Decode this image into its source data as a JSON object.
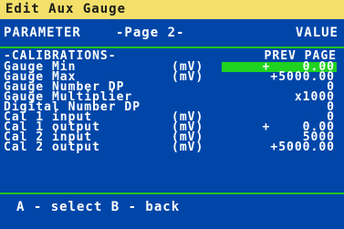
{
  "title": "Edit Aux Gauge",
  "header": {
    "parameter": "PARAMETER",
    "page": "-Page 2-",
    "value": "VALUE"
  },
  "section": {
    "label": "-CALIBRATIONS-",
    "prev_page": "PREV PAGE"
  },
  "rows": [
    {
      "label": "Gauge Min",
      "unit": "(mV)",
      "value": "+    0.00",
      "selected": true
    },
    {
      "label": "Gauge Max",
      "unit": "(mV)",
      "value": "+5000.00"
    },
    {
      "label": "Gauge Number DP",
      "unit": "",
      "value": "0"
    },
    {
      "label": "Gauge Multiplier",
      "unit": "",
      "value": "x1000"
    },
    {
      "label": "Digital Number DP",
      "unit": "",
      "value": "0"
    },
    {
      "label": "Cal 1 input",
      "unit": "(mV)",
      "value": "0"
    },
    {
      "label": "Cal 1 output",
      "unit": "(mV)",
      "value": "+    0.00"
    },
    {
      "label": "Cal 2 input",
      "unit": "(mV)",
      "value": "5000"
    },
    {
      "label": "Cal 2 output",
      "unit": "(mV)",
      "value": "+5000.00"
    }
  ],
  "footer": "A - select  B - back",
  "colors": {
    "background": "#0046a8",
    "titlebar": "#f2e06a",
    "rule": "#1fc51f",
    "selection": "#1fd21f"
  }
}
